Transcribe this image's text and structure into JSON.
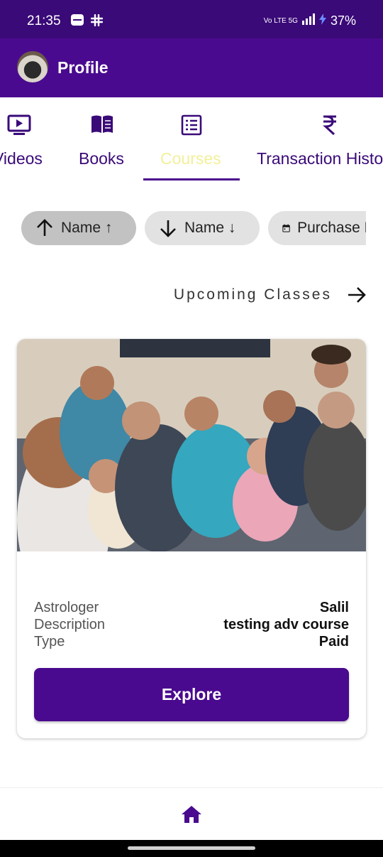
{
  "status_bar": {
    "time": "21:35",
    "network": "Vo LTE 5G",
    "battery": "37%"
  },
  "app_bar": {
    "title": "Profile"
  },
  "tabs": [
    {
      "label": "Videos",
      "icon": "video-player-icon"
    },
    {
      "label": "Books",
      "icon": "open-book-icon"
    },
    {
      "label": "Courses",
      "icon": "list-icon",
      "active": true
    },
    {
      "label": "Transaction History",
      "icon": "rupee-icon"
    }
  ],
  "sort_chips": [
    {
      "label": "Name ↑",
      "icon": "arrow-up-icon",
      "selected": true
    },
    {
      "label": "Name ↓",
      "icon": "arrow-down-icon"
    },
    {
      "label": "Purchase Date",
      "icon": "calendar-icon"
    }
  ],
  "upcoming": {
    "label": "Upcoming Classes"
  },
  "course_card": {
    "rows": [
      {
        "label": "Astrologer",
        "value": "Salil"
      },
      {
        "label": "Description",
        "value": "testing adv course"
      },
      {
        "label": "Type",
        "value": "Paid"
      }
    ],
    "button_label": "Explore"
  },
  "colors": {
    "primary": "#4a0a8f",
    "status_bar": "#3a0a78",
    "active_tab_text": "#f2f09a"
  }
}
